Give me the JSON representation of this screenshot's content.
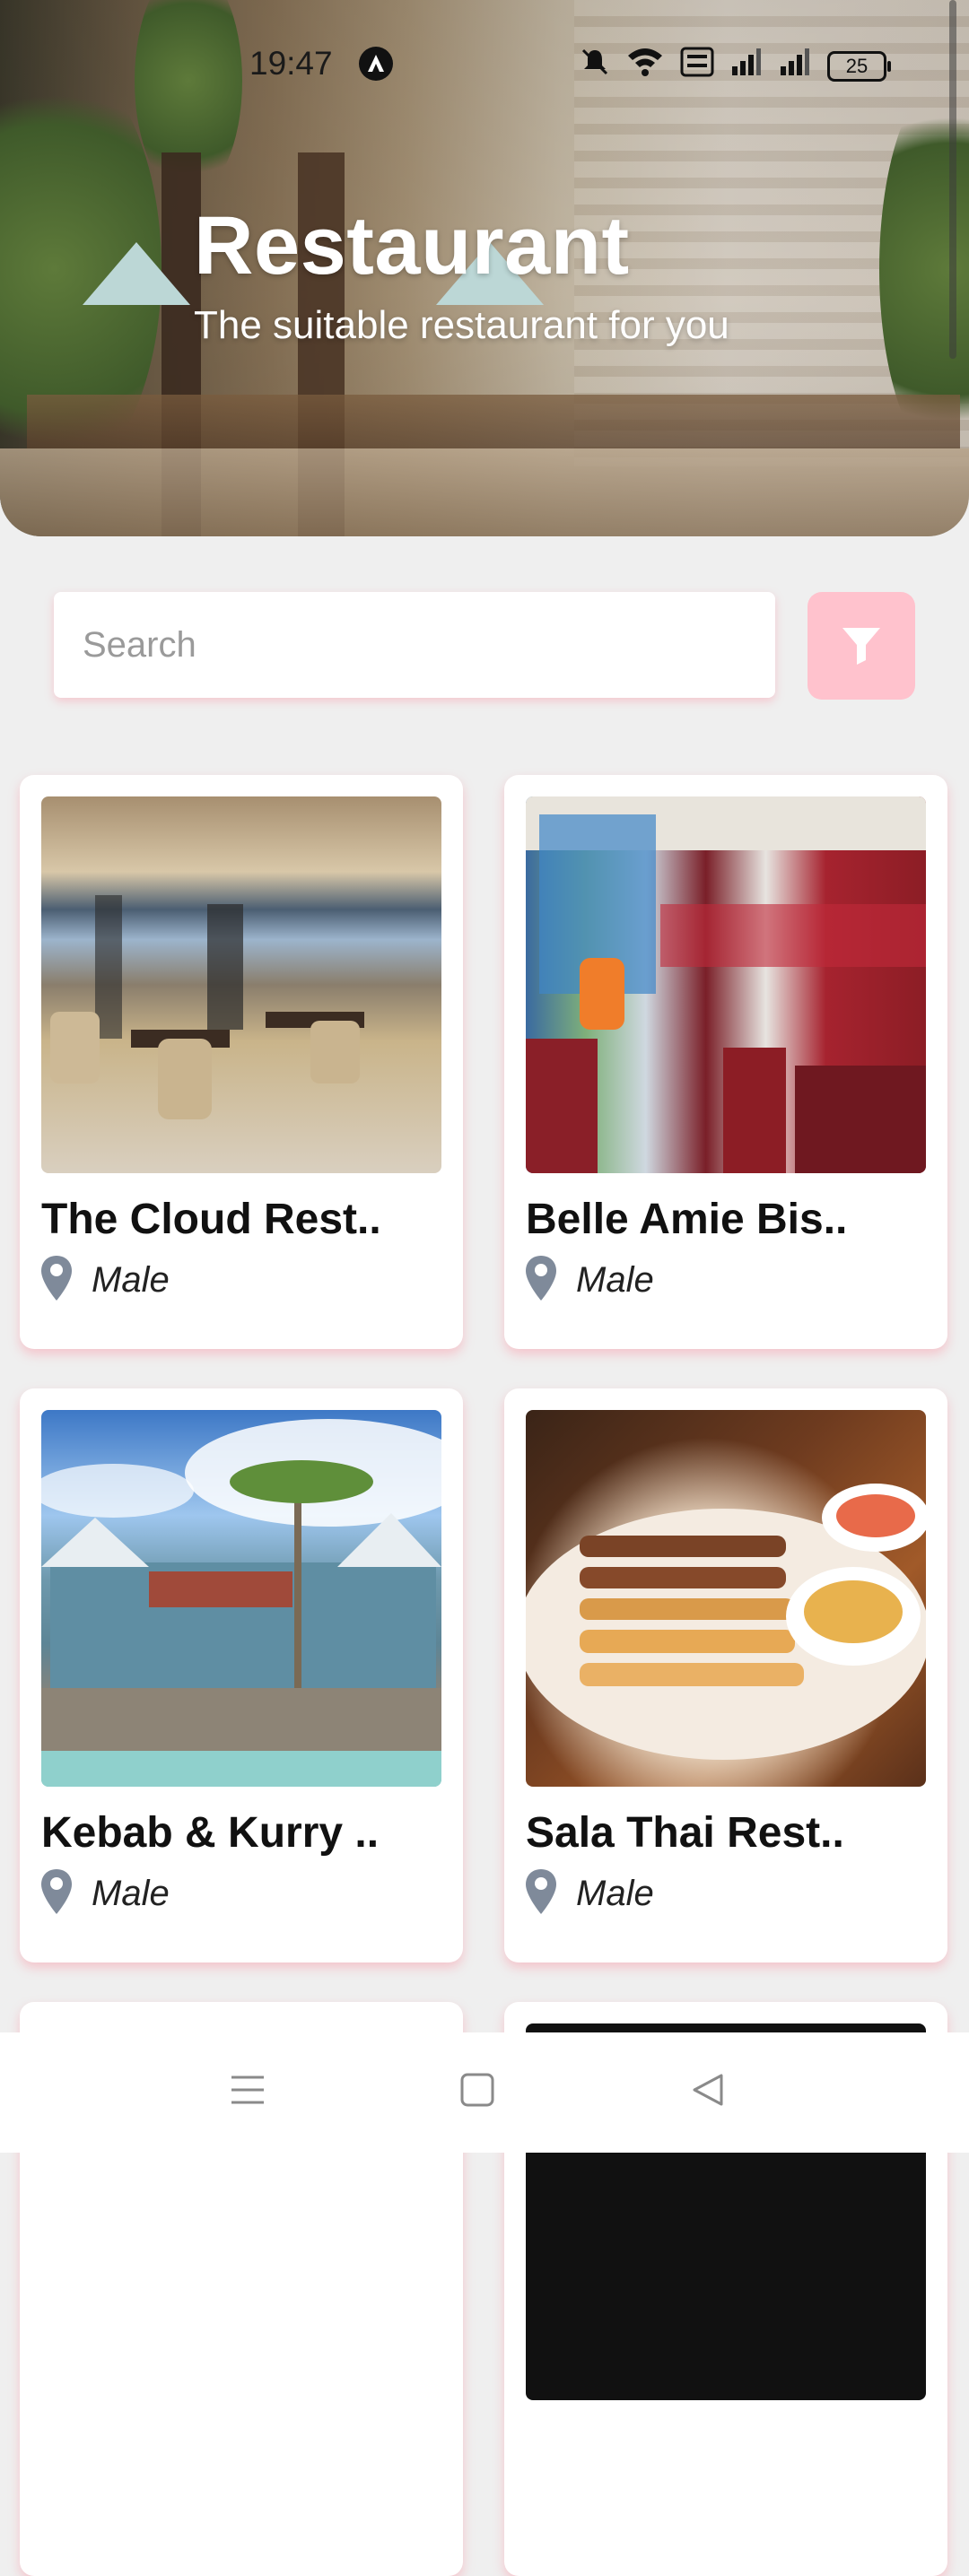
{
  "status_bar": {
    "time": "19:47",
    "battery": "25",
    "icons": [
      "app-notification-icon",
      "mute-icon",
      "wifi-icon",
      "volte-icon",
      "signal-icon",
      "signal-icon",
      "battery-icon"
    ]
  },
  "hero": {
    "title": "Restaurant",
    "subtitle": "The suitable restaurant for you"
  },
  "search": {
    "placeholder": "Search",
    "value": "",
    "filter_icon": "filter-icon",
    "filter_color": "#ffc2cd"
  },
  "restaurants": [
    {
      "name": "The Cloud Rest..",
      "location": "Male"
    },
    {
      "name": "Belle Amie Bis..",
      "location": "Male"
    },
    {
      "name": "Kebab & Kurry ..",
      "location": "Male"
    },
    {
      "name": "Sala Thai Rest..",
      "location": "Male"
    }
  ],
  "nav_bar": {
    "buttons": [
      "menu-icon",
      "home-icon",
      "back-icon"
    ]
  },
  "colors": {
    "accent": "#ffc2cd",
    "pin": "#7f8a9a",
    "background": "#efefef"
  }
}
